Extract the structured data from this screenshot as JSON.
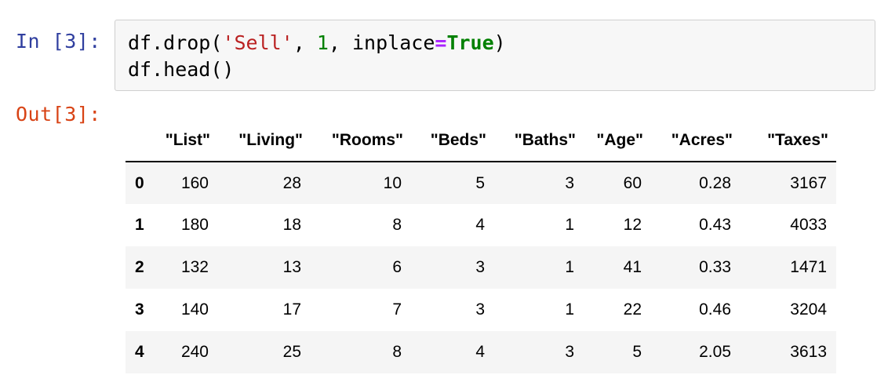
{
  "input_cell": {
    "prompt": "In [3]:",
    "code_line1": {
      "pre": "df.drop(",
      "str": "'Sell'",
      "sep1": ", ",
      "num": "1",
      "sep2": ", inplace",
      "op": "=",
      "kw": "True",
      "post": ")"
    },
    "code_line2": "df.head()"
  },
  "output_cell": {
    "prompt": "Out[3]:",
    "table": {
      "columns": [
        "\"List\"",
        "\"Living\"",
        "\"Rooms\"",
        "\"Beds\"",
        "\"Baths\"",
        "\"Age\"",
        "\"Acres\"",
        "\"Taxes\""
      ],
      "rows": [
        {
          "index": "0",
          "cells": [
            "160",
            "28",
            "10",
            "5",
            "3",
            "60",
            "0.28",
            "3167"
          ]
        },
        {
          "index": "1",
          "cells": [
            "180",
            "18",
            "8",
            "4",
            "1",
            "12",
            "0.43",
            "4033"
          ]
        },
        {
          "index": "2",
          "cells": [
            "132",
            "13",
            "6",
            "3",
            "1",
            "41",
            "0.33",
            "1471"
          ]
        },
        {
          "index": "3",
          "cells": [
            "140",
            "17",
            "7",
            "3",
            "1",
            "22",
            "0.46",
            "3204"
          ]
        },
        {
          "index": "4",
          "cells": [
            "240",
            "25",
            "8",
            "4",
            "3",
            "5",
            "2.05",
            "3613"
          ]
        }
      ]
    }
  },
  "colors": {
    "in_prompt": "#303F9F",
    "out_prompt": "#D84315",
    "string": "#BA2121",
    "number": "#008000",
    "operator": "#AA22FF",
    "keyword": "#008000",
    "cell_bg": "#f7f7f7",
    "row_stripe": "#f5f5f5"
  }
}
